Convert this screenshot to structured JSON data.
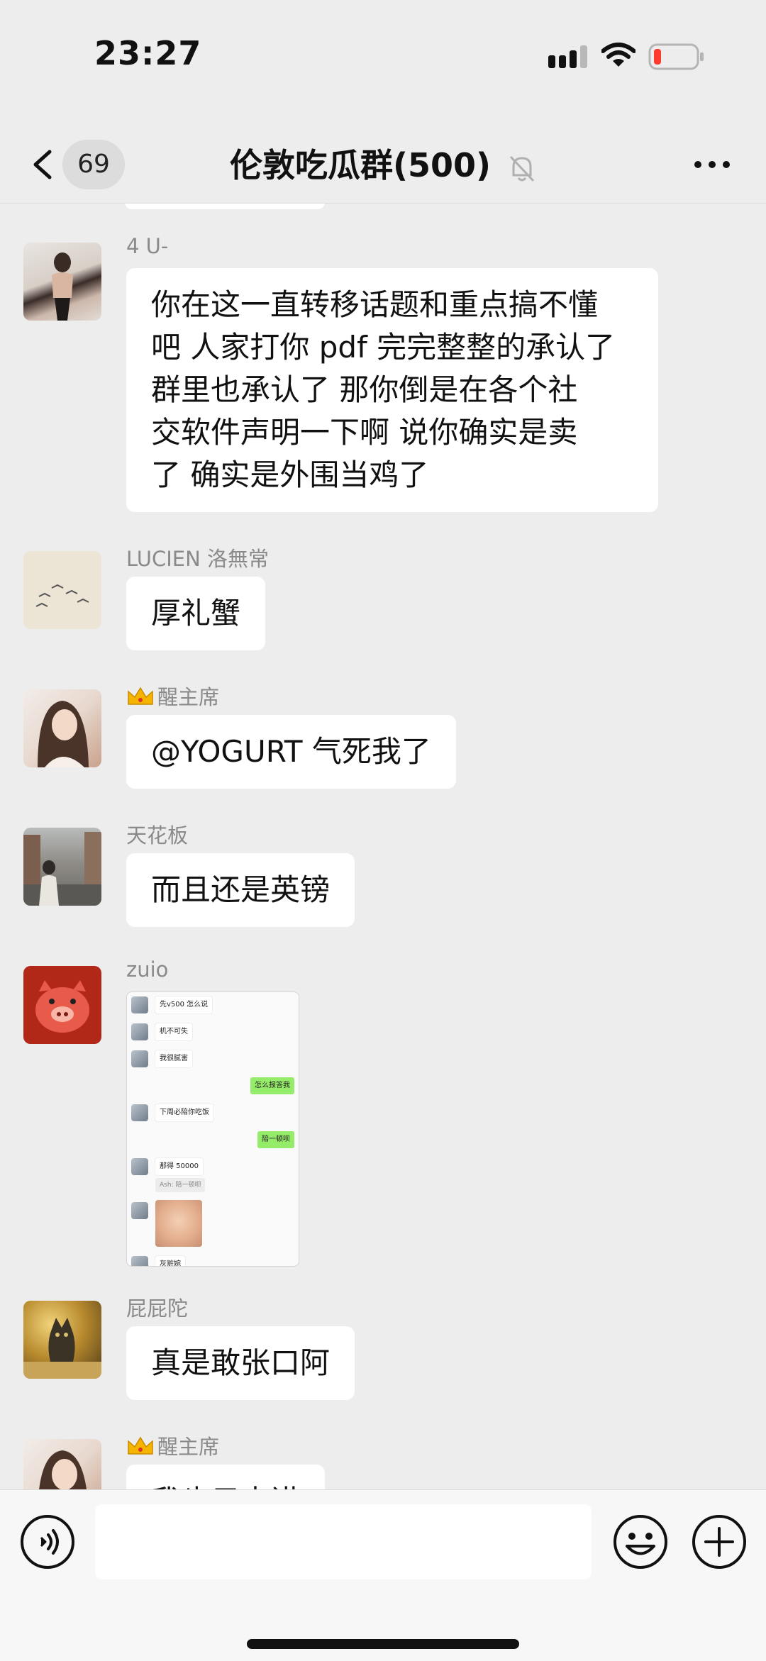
{
  "status_bar": {
    "time": "23:27",
    "signal_icon": "cellular-signal-icon",
    "wifi_icon": "wifi-icon",
    "battery_icon": "battery-low-icon",
    "battery_color": "#ff3b30"
  },
  "nav": {
    "back_icon": "chevron-left-icon",
    "unread_count": "69",
    "title": "伦敦吃瓜群(500)",
    "mute_icon": "bell-muted-icon",
    "more_icon": "more-horizontal-icon"
  },
  "messages": [
    {
      "sender": "4 U-",
      "text": "你在这一直转移话题和重点搞不懂吧 人家打你 pdf 完完整整的承认了 群里也承认了 那你倒是在各个社交软件声明一下啊 说你确实是卖了 确实是外围当鸡了",
      "text_lines": [
        "你在这一直转移话题和重点搞不懂",
        "吧 人家打你 pdf 完完整整的承认了",
        " 群里也承认了 那你倒是在各个社",
        "交软件声明一下啊 说你确实是卖",
        "了 确实是外围当鸡了"
      ]
    },
    {
      "sender": "LUCIEN 洛無常",
      "text": "厚礼蟹"
    },
    {
      "sender": "醒主席",
      "crown_icon": "crown-icon",
      "text": "@YOGURT 气死我了"
    },
    {
      "sender": "天花板",
      "text": "而且还是英镑"
    },
    {
      "sender": "zuio",
      "image": {
        "rows_left": [
          "先v500 怎么说",
          "机不可失",
          "我很腻害",
          "下周必陪你吃饭",
          "那得 50000",
          "灰赃婉"
        ],
        "rows_right": [
          "怎么报答我",
          "陪一顿呗"
        ],
        "quote": "Ash: 陪一顿呗"
      }
    },
    {
      "sender": "屁屁陀",
      "text": "真是敢张口阿"
    },
    {
      "sender": "醒主席",
      "crown_icon": "crown-icon",
      "text": "我也只去讲"
    }
  ],
  "input_bar": {
    "voice_icon": "voice-input-icon",
    "emoji_icon": "emoji-smile-icon",
    "plus_icon": "plus-circle-icon",
    "input_value": ""
  },
  "colors": {
    "background": "#ededed",
    "bubble": "#ffffff",
    "sender_name": "#8a8a8a",
    "sent_bubble_green": "#95ec69"
  }
}
